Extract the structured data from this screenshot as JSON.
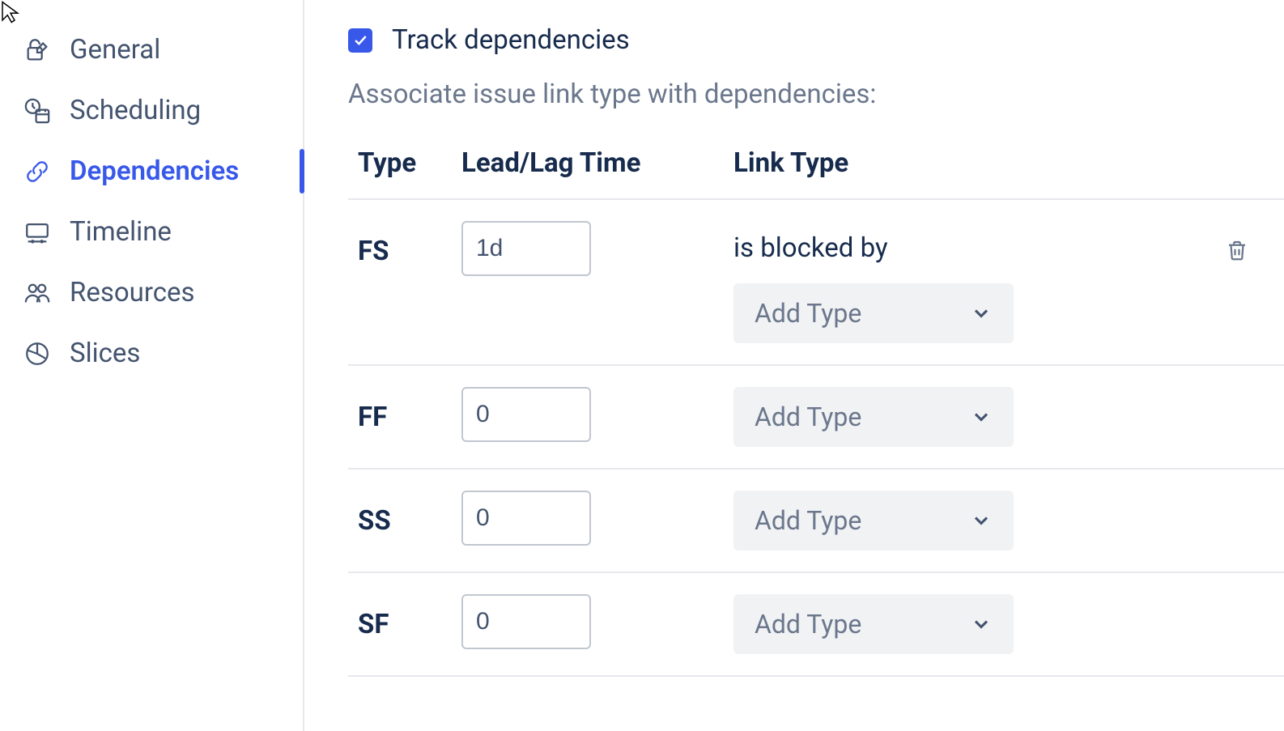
{
  "sidebar": {
    "items": [
      {
        "key": "general",
        "label": "General",
        "icon": "lock-pencil-icon"
      },
      {
        "key": "scheduling",
        "label": "Scheduling",
        "icon": "clock-calendar-icon"
      },
      {
        "key": "dependencies",
        "label": "Dependencies",
        "icon": "link-icon",
        "active": true
      },
      {
        "key": "timeline",
        "label": "Timeline",
        "icon": "timeline-icon"
      },
      {
        "key": "resources",
        "label": "Resources",
        "icon": "people-icon"
      },
      {
        "key": "slices",
        "label": "Slices",
        "icon": "pie-icon"
      }
    ]
  },
  "main": {
    "checkbox_label": "Track dependencies",
    "checkbox_checked": true,
    "subtitle": "Associate issue link type with dependencies:",
    "columns": {
      "type": "Type",
      "leadlag": "Lead/Lag Time",
      "linktype": "Link Type"
    },
    "add_type_placeholder": "Add Type",
    "rows": [
      {
        "type": "FS",
        "leadlag": "1d",
        "linktypes": [
          "is blocked by"
        ],
        "deletable": true
      },
      {
        "type": "FF",
        "leadlag": "0",
        "linktypes": []
      },
      {
        "type": "SS",
        "leadlag": "0",
        "linktypes": []
      },
      {
        "type": "SF",
        "leadlag": "0",
        "linktypes": []
      }
    ]
  }
}
